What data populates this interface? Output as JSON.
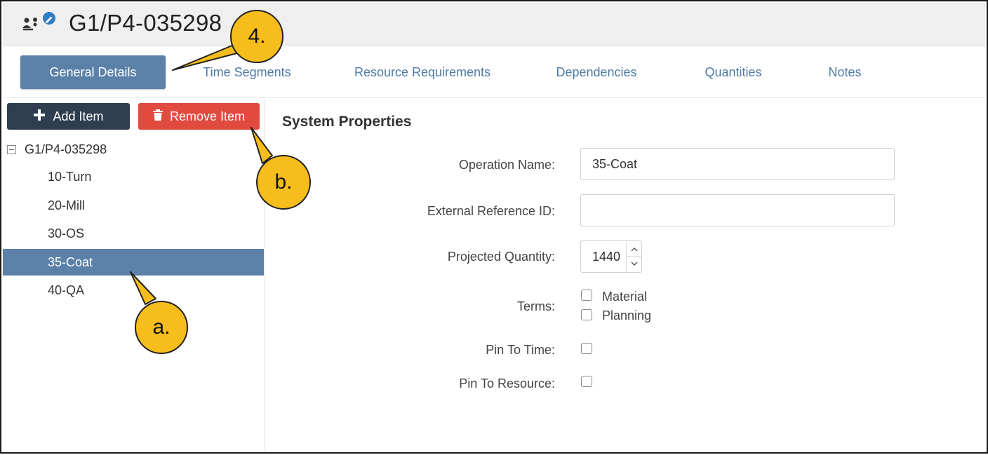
{
  "header": {
    "title": "G1/P4-035298",
    "icon": "operation-edit-icon"
  },
  "tabs": [
    {
      "label": "General Details",
      "active": true
    },
    {
      "label": "Time Segments"
    },
    {
      "label": "Resource Requirements"
    },
    {
      "label": "Dependencies"
    },
    {
      "label": "Quantities"
    },
    {
      "label": "Notes"
    }
  ],
  "left_panel": {
    "add_label": "Add Item",
    "remove_label": "Remove Item",
    "tree_root": "G1/P4-035298",
    "items": [
      {
        "label": "10-Turn"
      },
      {
        "label": "20-Mill"
      },
      {
        "label": "30-OS"
      },
      {
        "label": "35-Coat",
        "selected": true
      },
      {
        "label": "40-QA"
      }
    ]
  },
  "form": {
    "section_title": "System Properties",
    "operation_name_label": "Operation Name:",
    "operation_name_value": "35-Coat",
    "external_ref_label": "External Reference ID:",
    "external_ref_value": "",
    "projected_quantity_label": "Projected Quantity:",
    "projected_quantity_value": "1440",
    "terms_label": "Terms:",
    "terms_options": [
      "Material",
      "Planning"
    ],
    "pin_to_time_label": "Pin To Time:",
    "pin_to_resource_label": "Pin To Resource:"
  },
  "callouts": {
    "tabs": "4.",
    "tree": "a.",
    "remove": "b."
  },
  "colors": {
    "accent": "#5b81a9",
    "danger": "#e04a3f",
    "dark": "#2e3e50",
    "callout": "#f7bd1c"
  }
}
